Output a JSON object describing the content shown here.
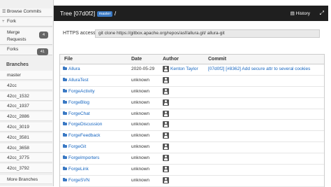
{
  "sidebar": {
    "browse": "Browse Commits",
    "fork": "Fork",
    "merge_requests": "Merge Requests",
    "merge_requests_count": "4",
    "forks": "Forks",
    "forks_count": "41",
    "branches_title": "Branches",
    "branches": [
      "master",
      "42cc",
      "42cc_1532",
      "42cc_1937",
      "42cc_2886",
      "42cc_3019",
      "42cc_3581",
      "42cc_3658",
      "42cc_3775",
      "42cc_3792"
    ],
    "more_branches": "More Branches"
  },
  "header": {
    "title": "Tree [07d0f2]",
    "branch_badge": "master",
    "separator": "/",
    "history": "History"
  },
  "clone": {
    "label": "HTTPS access",
    "url": "git clone https://gitbox.apache.org/repos/asf/allura.git/ allura-git"
  },
  "table": {
    "headers": {
      "file": "File",
      "date": "Date",
      "author": "Author",
      "commit": "Commit"
    },
    "rows": [
      {
        "name": "Allura",
        "date": "2020-05-29",
        "author": "Kenton Taylor",
        "commit": "[07d0f2] [#8362] Add secure attr to several cookies"
      },
      {
        "name": "AlluraTest",
        "date": "unknown",
        "author": "",
        "commit": ""
      },
      {
        "name": "ForgeActivity",
        "date": "unknown",
        "author": "",
        "commit": ""
      },
      {
        "name": "ForgeBlog",
        "date": "unknown",
        "author": "",
        "commit": ""
      },
      {
        "name": "ForgeChat",
        "date": "unknown",
        "author": "",
        "commit": ""
      },
      {
        "name": "ForgeDiscussion",
        "date": "unknown",
        "author": "",
        "commit": ""
      },
      {
        "name": "ForgeFeedback",
        "date": "unknown",
        "author": "",
        "commit": ""
      },
      {
        "name": "ForgeGit",
        "date": "unknown",
        "author": "",
        "commit": ""
      },
      {
        "name": "ForgeImporters",
        "date": "unknown",
        "author": "",
        "commit": ""
      },
      {
        "name": "ForgeLink",
        "date": "unknown",
        "author": "",
        "commit": ""
      },
      {
        "name": "ForgeSVN",
        "date": "unknown",
        "author": "",
        "commit": ""
      }
    ]
  }
}
